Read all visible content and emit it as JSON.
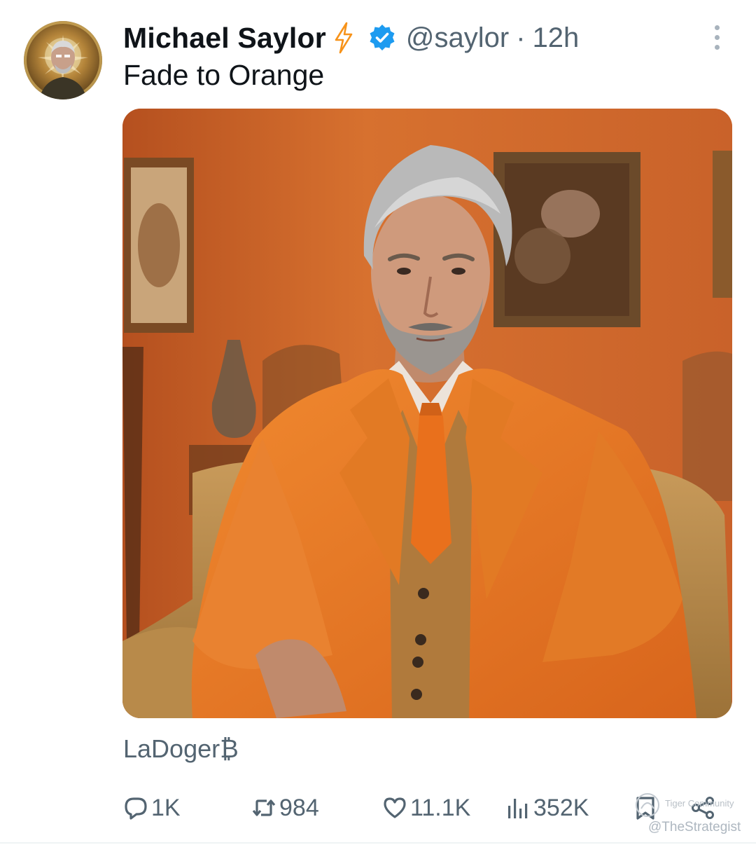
{
  "post": {
    "author_name": "Michael Saylor",
    "handle": "@saylor",
    "separator": "·",
    "time": "12h",
    "text": "Fade to Orange",
    "source_label": "LaDoger₿"
  },
  "icons": {
    "author_badge": "lightning-bolt-icon",
    "verified": "verified-badge-icon",
    "more": "more-options-icon",
    "reply": "reply-icon",
    "retweet": "retweet-icon",
    "like": "like-icon",
    "views": "views-icon",
    "bookmark": "bookmark-icon",
    "share": "share-icon"
  },
  "actions": {
    "replies": "1K",
    "reposts": "984",
    "likes": "11.1K",
    "views": "352K"
  },
  "watermark": {
    "line1": "Tiger Community",
    "line2": "@TheStrategist"
  },
  "colors": {
    "text_primary": "#0f1419",
    "text_secondary": "#536471",
    "verified_blue": "#1d9bf0",
    "bolt_orange": "#f7931a"
  }
}
